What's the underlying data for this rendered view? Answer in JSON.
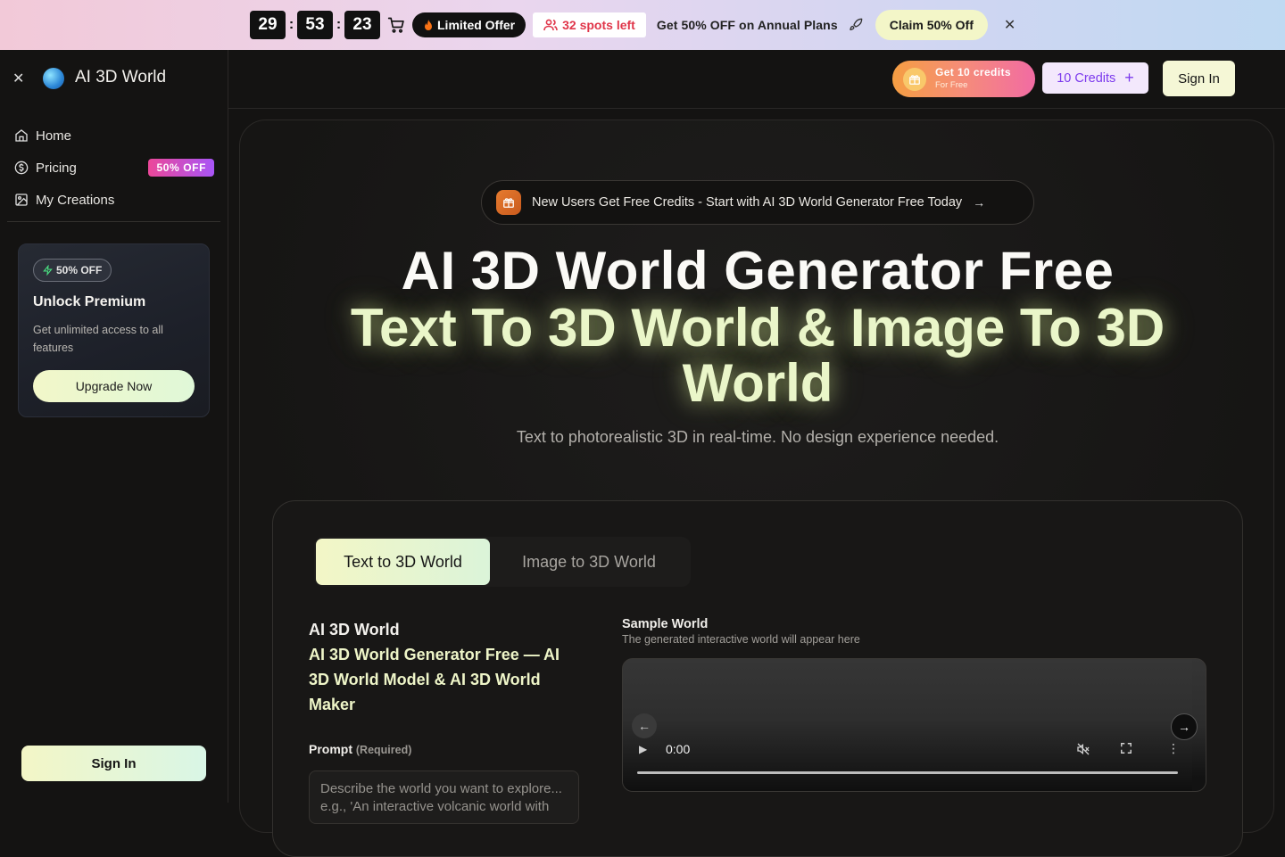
{
  "promo": {
    "timer": {
      "minutes": "29",
      "seconds": "53",
      "centis": "23",
      "separator": ":"
    },
    "limited_label": "Limited Offer",
    "spots_label": "32 spots left",
    "offer_text": "Get 50% OFF on Annual Plans",
    "claim_label": "Claim 50% Off",
    "close_glyph": "✕"
  },
  "sidebar": {
    "close_glyph": "✕",
    "app_title": "AI 3D World",
    "items": [
      {
        "label": "Home",
        "icon": "home-icon"
      },
      {
        "label": "Pricing",
        "icon": "dollar-icon",
        "badge": "50% OFF"
      },
      {
        "label": "My Creations",
        "icon": "image-icon"
      }
    ],
    "premium": {
      "badge": "50% OFF",
      "title": "Unlock Premium",
      "description": "Get unlimited access to all features",
      "button": "Upgrade Now"
    },
    "signin_label": "Sign In"
  },
  "topbar": {
    "get_credits_line1": "Get 10 credits",
    "get_credits_line2": "For Free",
    "credits_label": "10 Credits",
    "credits_plus": "+",
    "signin_label": "Sign In"
  },
  "hero": {
    "announcement": "New Users Get Free Credits - Start with AI 3D World Generator Free Today",
    "announcement_arrow": "→",
    "title": "AI 3D World Generator Free",
    "headline": "Text To 3D World & Image To 3D World",
    "subtitle": "Text to photorealistic 3D in real-time. No design experience needed."
  },
  "generator": {
    "tabs": [
      {
        "label": "Text to 3D World",
        "active": true
      },
      {
        "label": "Image to 3D World",
        "active": false
      }
    ],
    "left": {
      "title": "AI 3D World",
      "subtitle": "AI 3D World Generator Free — AI 3D World Model & AI 3D World Maker",
      "prompt_label": "Prompt",
      "prompt_required": "(Required)",
      "prompt_placeholder": "Describe the world you want to explore... e.g., 'An interactive volcanic world with"
    },
    "right": {
      "title": "Sample World",
      "description": "The generated interactive world will appear here",
      "video": {
        "time": "0:00",
        "prev": "←",
        "next": "→"
      }
    }
  },
  "colors": {
    "accent_lime": "#eaf6c9",
    "badge_pink": "#ec4899",
    "badge_purple": "#a855f7",
    "credits_purple": "#7c3aed",
    "spots_red": "#e0364a"
  }
}
